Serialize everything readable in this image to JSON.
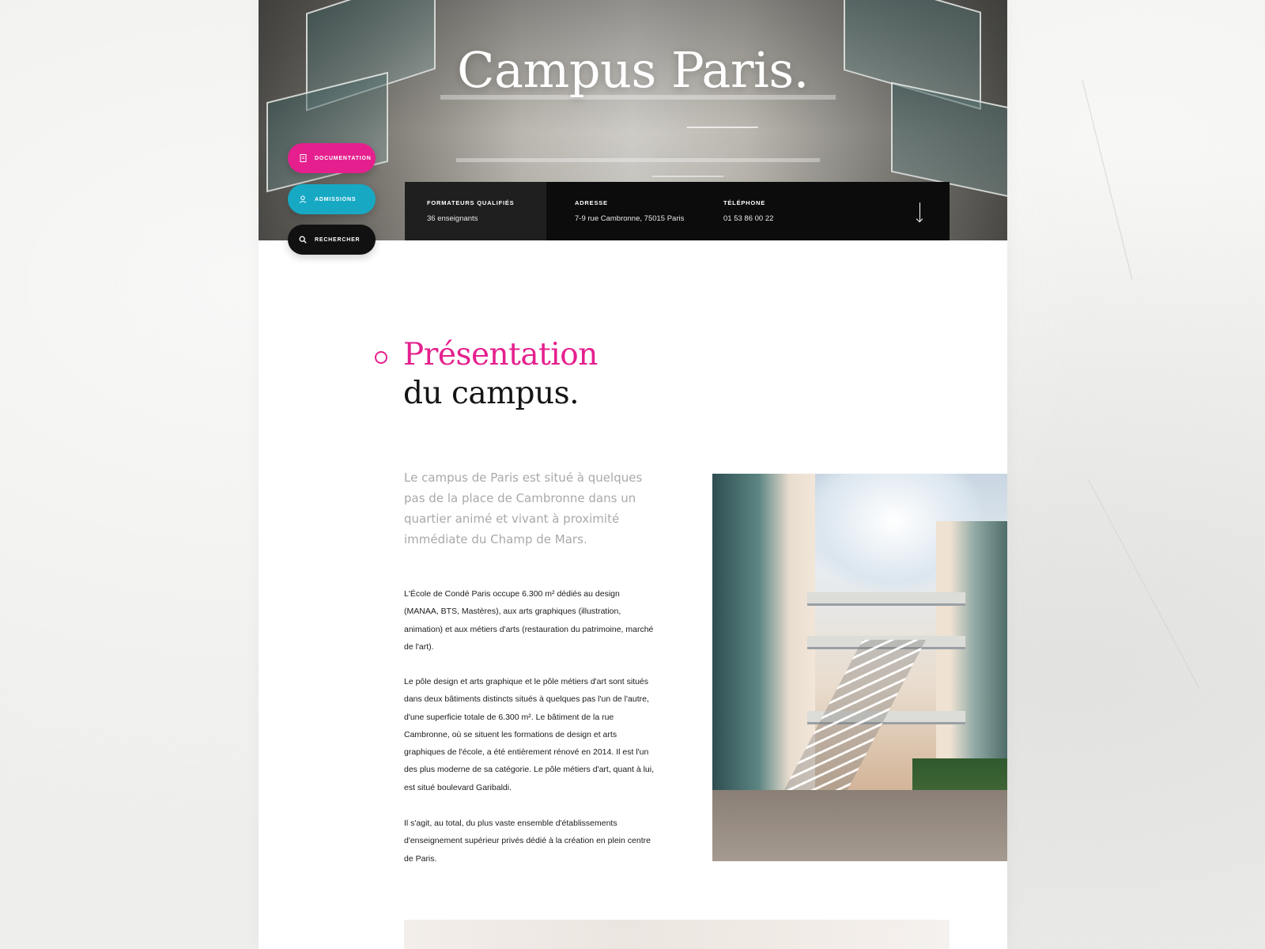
{
  "hero": {
    "title": "Campus Paris."
  },
  "actions": {
    "documentation": "DOCUMENTATION",
    "admissions": "ADMISSIONS",
    "search": "RECHERCHER"
  },
  "info": [
    {
      "label": "FORMATEURS QUALIFIÉS",
      "value": "36 enseignants"
    },
    {
      "label": "ADRESSE",
      "value": "7-9 rue Cambronne, 75015 Paris"
    },
    {
      "label": "TÉLÉPHONE",
      "value": "01 53 86 00 22"
    }
  ],
  "section": {
    "title_accent": "Présentation",
    "title_rest": "du campus.",
    "lead": "Le campus de Paris est situé à quelques pas de la place de Cambronne dans un quartier animé et vivant à proximité immédiate du Champ de Mars.",
    "paragraphs": [
      "L'École de Condé Paris occupe 6.300 m² dédiés au design (MANAA, BTS, Mastères), aux arts graphiques (illustration, animation) et aux métiers d'arts (restauration du patrimoine, marché de l'art).",
      "Le pôle design et arts graphique et le pôle métiers d'art sont situés dans deux bâtiments distincts situés à quelques pas l'un de l'autre, d'une superficie totale de 6.300 m². Le bâtiment de la rue Cambronne, où se situent les formations de design et arts graphiques de l'école, a été entièrement rénové en 2014. Il est l'un des plus moderne de sa catégorie. Le pôle métiers d'art, quant à lui, est situé boulevard Garibaldi.",
      "Il s'agit, au total, du plus vaste ensemble d'établissements d'enseignement supérieur privés dédié à la création en plein centre de Paris."
    ]
  },
  "colors": {
    "accent_pink": "#e5208e",
    "accent_cyan": "#17a9c4",
    "dark": "#111111"
  },
  "icons": {
    "documentation": "document-icon",
    "admissions": "user-icon",
    "search": "search-icon",
    "scroll": "arrow-down-icon"
  }
}
